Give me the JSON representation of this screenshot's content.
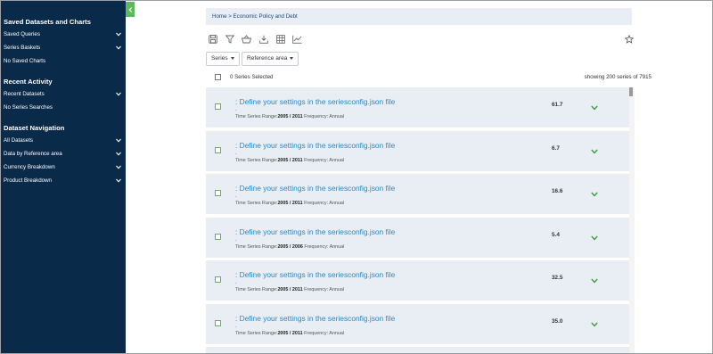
{
  "sidebar": {
    "sections": [
      {
        "heading": "Saved Datasets and Charts",
        "items": [
          {
            "label": "Saved Queries",
            "expandable": true
          },
          {
            "label": "Series Baskets",
            "expandable": true
          },
          {
            "label": "No Saved Charts",
            "expandable": false
          }
        ]
      },
      {
        "heading": "Recent Activity",
        "items": [
          {
            "label": "Recent Datasets",
            "expandable": true
          },
          {
            "label": "No Series Searches",
            "expandable": false
          }
        ]
      },
      {
        "heading": "Dataset Navigation",
        "items": [
          {
            "label": "All Datasets",
            "expandable": true
          },
          {
            "label": "Data by Reference area",
            "expandable": true
          },
          {
            "label": "Currency Breakdown",
            "expandable": true
          },
          {
            "label": "Product Breakdown",
            "expandable": true
          }
        ]
      }
    ]
  },
  "breadcrumb": "Home > Economic Policy and Debt",
  "toolbar": {
    "icons": [
      "save-icon",
      "filter-icon",
      "basket-icon",
      "download-icon",
      "table-icon",
      "chart-icon"
    ]
  },
  "favorite_icon": "star-icon",
  "filters": {
    "series_label": "Series",
    "reference_area_label": "Reference area"
  },
  "selection": {
    "selected_text": "0 Series Selected",
    "showing_text": "showing 200 series of 7915"
  },
  "series_list": [
    {
      "title": ": Define your settings in the seriesconfig.json file",
      "dot": ".",
      "range_label": "Time Series Range:",
      "range": "2005 / 2011",
      "freq_label": "Frequency:",
      "freq": "Annual",
      "value": "61.7"
    },
    {
      "title": ": Define your settings in the seriesconfig.json file",
      "dot": ".",
      "range_label": "Time Series Range:",
      "range": "2005 / 2011",
      "freq_label": "Frequency:",
      "freq": "Annual",
      "value": "6.7"
    },
    {
      "title": ": Define your settings in the seriesconfig.json file",
      "dot": ".",
      "range_label": "Time Series Range:",
      "range": "2005 / 2011",
      "freq_label": "Frequency:",
      "freq": "Annual",
      "value": "16.6"
    },
    {
      "title": ": Define your settings in the seriesconfig.json file",
      "dot": ".",
      "range_label": "Time Series Range:",
      "range": "2005 / 2006",
      "freq_label": "Frequency:",
      "freq": "Annual",
      "value": "5.4"
    },
    {
      "title": ": Define your settings in the seriesconfig.json file",
      "dot": ".",
      "range_label": "Time Series Range:",
      "range": "2005 / 2011",
      "freq_label": "Frequency:",
      "freq": "Annual",
      "value": "32.5"
    },
    {
      "title": ": Define your settings in the seriesconfig.json file",
      "dot": ".",
      "range_label": "Time Series Range:",
      "range": "2005 / 2011",
      "freq_label": "Frequency:",
      "freq": "Annual",
      "value": "35.0"
    }
  ],
  "colors": {
    "sidebar_bg": "#0a2a4a",
    "accent_green": "#5cb85c",
    "link_blue": "#2a8ac8",
    "row_bg": "#e8eef3"
  }
}
